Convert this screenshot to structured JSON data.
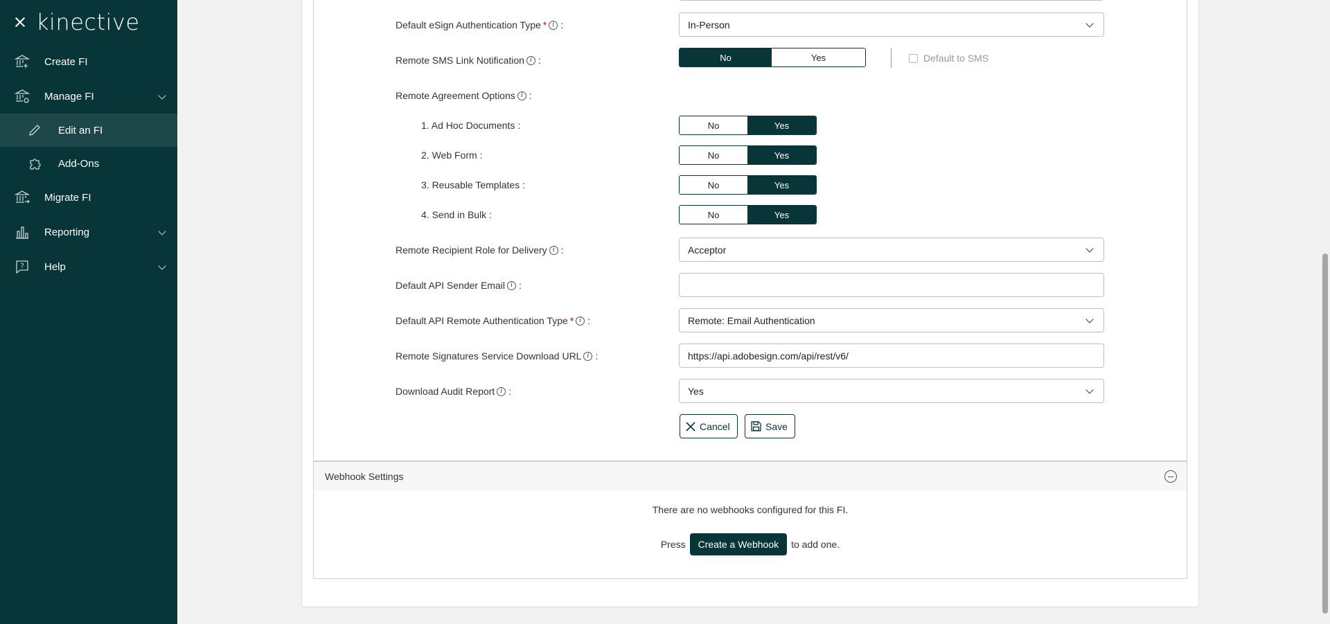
{
  "sidebar": {
    "logo": "kinective",
    "items": [
      {
        "label": "Create FI"
      },
      {
        "label": "Manage FI"
      },
      {
        "label": "Edit an FI"
      },
      {
        "label": "Add-Ons"
      },
      {
        "label": "Migrate FI"
      },
      {
        "label": "Reporting"
      },
      {
        "label": "Help"
      }
    ]
  },
  "form": {
    "esign_auth": {
      "label": "Default eSign Authentication Type",
      "value": "In-Person"
    },
    "sms_link": {
      "label": "Remote SMS Link Notification",
      "no": "No",
      "yes": "Yes",
      "selected": "No",
      "default_sms": "Default to SMS"
    },
    "agreement_options": {
      "label": "Remote Agreement Options"
    },
    "options": [
      {
        "label": "1. Ad Hoc Documents :",
        "no": "No",
        "yes": "Yes",
        "selected": "Yes"
      },
      {
        "label": "2. Web Form :",
        "no": "No",
        "yes": "Yes",
        "selected": "Yes"
      },
      {
        "label": "3. Reusable Templates :",
        "no": "No",
        "yes": "Yes",
        "selected": "Yes"
      },
      {
        "label": "4. Send in Bulk :",
        "no": "No",
        "yes": "Yes",
        "selected": "Yes"
      }
    ],
    "recipient_role": {
      "label": "Remote Recipient Role for Delivery",
      "value": "Acceptor"
    },
    "api_sender_email": {
      "label": "Default API Sender Email",
      "value": ""
    },
    "api_remote_auth": {
      "label": "Default API Remote Authentication Type",
      "value": "Remote: Email Authentication"
    },
    "download_url": {
      "label": "Remote Signatures Service Download URL",
      "value": "https://api.adobesign.com/api/rest/v6/"
    },
    "audit_report": {
      "label": "Download Audit Report",
      "value": "Yes"
    },
    "cancel": "Cancel",
    "save": "Save"
  },
  "webhooks": {
    "title": "Webhook Settings",
    "empty_message": "There are no webhooks configured for this FI.",
    "press": "Press",
    "create_button": "Create a Webhook",
    "suffix": "to add one."
  },
  "colors": {
    "brand": "#073538",
    "required": "#d0021b"
  }
}
